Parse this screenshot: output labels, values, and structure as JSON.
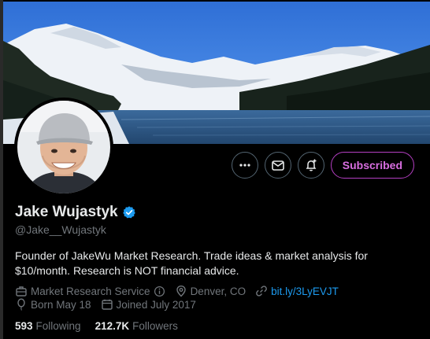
{
  "profile": {
    "name": "Jake Wujastyk",
    "handle": "@Jake__Wujastyk",
    "bio": "Founder of JakeWu Market Research. Trade ideas & market analysis for $10/month. Research is NOT financial advice.",
    "category": "Market Research Service",
    "location": "Denver, CO",
    "website": "bit.ly/3LyEVJT",
    "birthday": "Born May 18",
    "joined": "Joined July 2017",
    "following_count": "593",
    "following_label": "Following",
    "followers_count": "212.7K",
    "followers_label": "Followers"
  },
  "actions": {
    "more_icon": "more-horizontal-icon",
    "message_icon": "envelope-icon",
    "notify_icon": "bell-plus-icon",
    "subscribed_label": "Subscribed"
  },
  "colors": {
    "background": "#000000",
    "text_primary": "#e7e9ea",
    "text_secondary": "#71767b",
    "link": "#1d9bf0",
    "verified": "#1d9bf0",
    "subscribed_accent": "#d86ee0"
  }
}
